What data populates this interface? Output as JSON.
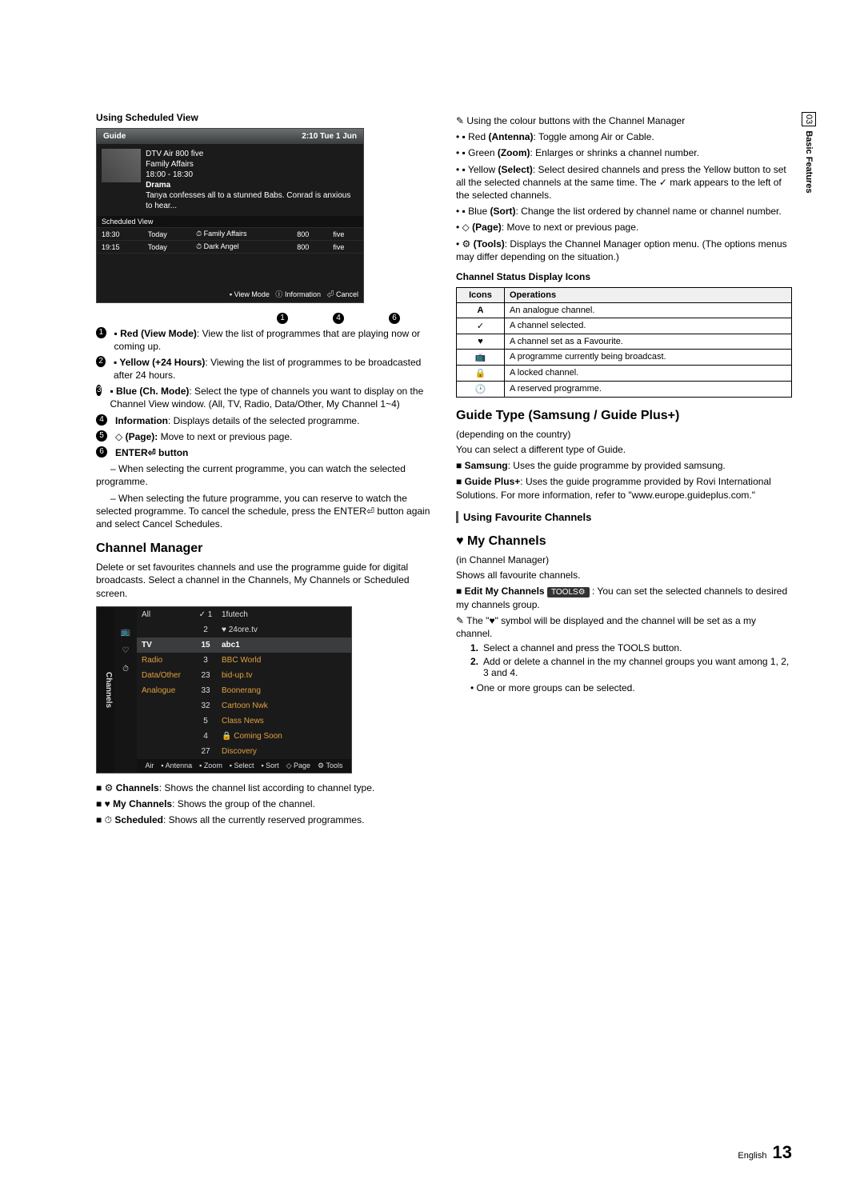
{
  "side_tab": {
    "num": "03",
    "label": "Basic Features"
  },
  "left": {
    "usv_title": "Using Scheduled View",
    "guide": {
      "title": "Guide",
      "clock": "2:10 Tue 1 Jun",
      "chan": "DTV Air 800 five",
      "prog": "Family Affairs",
      "time": "18:00 - 18:30",
      "genre": "Drama",
      "synopsis": "Tanya confesses all to a stunned Babs. Conrad is anxious to hear...",
      "sched_label": "Scheduled View",
      "rows": [
        {
          "t": "18:30",
          "d": "Today",
          "p": "Family Affairs",
          "n": "800",
          "c": "five"
        },
        {
          "t": "19:15",
          "d": "Today",
          "p": "Dark Angel",
          "n": "800",
          "c": "five"
        }
      ],
      "foot_view": "View Mode",
      "foot_info": "Information",
      "foot_cancel": "Cancel"
    },
    "callouts": {
      "c1": "1",
      "c4": "4",
      "c6": "6"
    },
    "options": [
      {
        "n": "1",
        "pre": "Red",
        "label": "(View Mode)",
        "text": ": View the list of programmes that are playing now or coming up."
      },
      {
        "n": "2",
        "pre": "Yellow",
        "label": "(+24 Hours)",
        "text": ": Viewing the list of programmes to be broadcasted after 24 hours."
      },
      {
        "n": "3",
        "pre": "Blue",
        "label": "(Ch. Mode)",
        "text": ": Select the type of channels you want to display on the Channel View window. (All, TV, Radio, Data/Other, My Channel 1~4)"
      },
      {
        "n": "4",
        "pre": "",
        "label": "Information",
        "text": ": Displays details of the selected programme."
      },
      {
        "n": "5",
        "pre": "◇",
        "label": "(Page):",
        "text": " Move to next or previous page."
      },
      {
        "n": "6",
        "pre": "",
        "label": "ENTER⏎ button",
        "text": ""
      }
    ],
    "sub_enter": [
      "When selecting the current programme, you can watch the selected programme.",
      "When selecting the future programme, you can reserve to watch the selected programme. To cancel the schedule, press the ENTER⏎ button again and select Cancel Schedules."
    ],
    "cm_title": "Channel Manager",
    "cm_intro": "Delete or set favourites channels and use the programme guide for digital broadcasts. Select a channel in the Channels, My Channels or Scheduled screen.",
    "cm": {
      "side": "Channels",
      "cats": [
        "All",
        "TV",
        "Radio",
        "Data/Other",
        "Analogue"
      ],
      "rows": [
        {
          "n": "1",
          "name": "1futech",
          "mark": "✓"
        },
        {
          "n": "2",
          "name": "24ore.tv",
          "mark": "♥"
        },
        {
          "n": "15",
          "name": "abc1",
          "mark": ""
        },
        {
          "n": "3",
          "name": "BBC World",
          "mark": ""
        },
        {
          "n": "23",
          "name": "bid-up.tv",
          "mark": ""
        },
        {
          "n": "33",
          "name": "Boonerang",
          "mark": ""
        },
        {
          "n": "32",
          "name": "Cartoon Nwk",
          "mark": ""
        },
        {
          "n": "5",
          "name": "Class News",
          "mark": ""
        },
        {
          "n": "4",
          "name": "Coming Soon",
          "mark": "🔒"
        },
        {
          "n": "27",
          "name": "Discovery",
          "mark": ""
        }
      ],
      "foot_air": "Air",
      "foot": [
        "Antenna",
        "Zoom",
        "Select",
        "Sort",
        "Page",
        "Tools"
      ]
    },
    "cm_notes": [
      {
        "icon": "⚙",
        "label": "Channels",
        "text": ": Shows the channel list according to channel type."
      },
      {
        "icon": "♥",
        "label": "My Channels",
        "text": ": Shows the group of the channel."
      },
      {
        "icon": "⏱",
        "label": "Scheduled",
        "text": ": Shows all the currently reserved programmes."
      }
    ]
  },
  "right": {
    "colour_intro": "Using the colour buttons with the Channel Manager",
    "colour": [
      {
        "pre": "Red",
        "label": "(Antenna)",
        "text": ": Toggle among Air or Cable."
      },
      {
        "pre": "Green",
        "label": "(Zoom)",
        "text": ": Enlarges or shrinks a channel number."
      },
      {
        "pre": "Yellow",
        "label": "(Select)",
        "text": ": Select desired channels and press the Yellow button to set all the selected channels at the same time. The ✓ mark appears to the left of the selected channels."
      },
      {
        "pre": "Blue",
        "label": "(Sort)",
        "text": ": Change the list ordered by channel name or channel number."
      },
      {
        "pre": "◇",
        "label": "(Page)",
        "text": ": Move to next or previous page."
      },
      {
        "pre": "⚙",
        "label": "(Tools)",
        "text": ": Displays the Channel Manager option menu. (The options menus may differ depending on the situation.)"
      }
    ],
    "icons_title": "Channel Status Display Icons",
    "icons_th1": "Icons",
    "icons_th2": "Operations",
    "icons": [
      {
        "i": "A",
        "t": "An analogue channel."
      },
      {
        "i": "✓",
        "t": "A channel selected."
      },
      {
        "i": "♥",
        "t": "A channel set as a Favourite."
      },
      {
        "i": "📺",
        "t": "A programme currently being broadcast."
      },
      {
        "i": "🔒",
        "t": "A locked channel."
      },
      {
        "i": "🕑",
        "t": "A reserved programme."
      }
    ],
    "guide_type_title": "Guide Type (Samsung / Guide Plus+)",
    "guide_type_note": "(depending on the country)",
    "guide_type_intro": "You can select a different type of Guide.",
    "guide_type_items": [
      {
        "label": "Samsung",
        "text": ": Uses the guide programme by provided samsung."
      },
      {
        "label": "Guide Plus+",
        "text": ": Uses the guide programme provided by Rovi International Solutions. For more information, refer to \"www.europe.guideplus.com.\""
      }
    ],
    "fav_title": "Using Favourite Channels",
    "mychan_title": "My Channels",
    "mychan_in": "(in Channel Manager)",
    "mychan_intro": "Shows all favourite channels.",
    "edit_label": "Edit My Channels",
    "edit_key": "TOOLS⚙",
    "edit_text": ": You can set the selected channels to desired my channels group.",
    "heart_note": "The \"♥\" symbol will be displayed and the channel will be set as a my channel.",
    "steps": [
      {
        "n": "1.",
        "t": "Select a channel and press the TOOLS button."
      },
      {
        "n": "2.",
        "t": "Add or delete a channel in the my channel groups you want among 1, 2, 3 and 4."
      }
    ],
    "step_sub": "One or more groups can be selected."
  },
  "footer": {
    "lang": "English",
    "page": "13"
  }
}
